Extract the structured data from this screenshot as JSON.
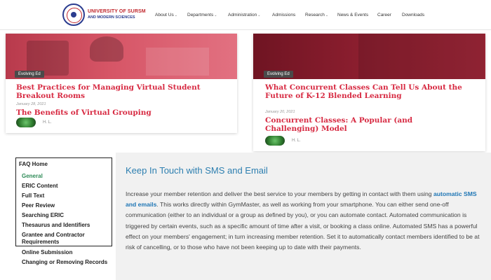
{
  "header": {
    "logo_line1": "UNIVERSITY OF SURSM",
    "logo_line2": "AND MODERN SCIENCES",
    "nav": [
      {
        "label": "About Us",
        "dropdown": true
      },
      {
        "label": "Departments",
        "dropdown": true
      },
      {
        "label": "Administration",
        "dropdown": true
      },
      {
        "label": "Admissions",
        "dropdown": false
      },
      {
        "label": "Research",
        "dropdown": true
      },
      {
        "label": "News & Events",
        "dropdown": false
      },
      {
        "label": "Career",
        "dropdown": false
      },
      {
        "label": "Downloads",
        "dropdown": false
      }
    ]
  },
  "cards": [
    {
      "tag": "Evolving Ed",
      "title": "Best Practices for Managing Virtual Student Breakout Rooms",
      "date": "January 28, 2021",
      "title2": "The Benefits of Virtual Grouping",
      "author": "H. L."
    },
    {
      "tag": "Evolving Ed",
      "title": "What Concurrent Classes Can Tell Us About the Future of K-12 Blended Learning",
      "date": "January 20, 2021",
      "title2": "Concurrent Classes: A Popular (and Challenging) Model",
      "author": "H. L."
    }
  ],
  "sidebar": {
    "items": [
      {
        "label": "FAQ Home"
      },
      {
        "label": "General"
      },
      {
        "label": "ERIC Content"
      },
      {
        "label": "Full Text"
      },
      {
        "label": "Peer Review"
      },
      {
        "label": "Searching ERIC"
      },
      {
        "label": "Thesaurus and Identifiers"
      },
      {
        "label": "Grantee and Contractor Requirements"
      },
      {
        "label": "Online Submission"
      },
      {
        "label": "Changing or Removing Records"
      }
    ]
  },
  "main": {
    "heading": "Keep In Touch with SMS and Email",
    "text_before_link": "Increase your member retention and deliver the best service to your members by getting in contact with them using ",
    "link_text": "automatic SMS and emails",
    "text_after_link": ". This works directly within GymMaster, as well as working from your smartphone. You can either send one-off communication (either to an individual or a group as defined by you), or you can automate contact. Automated communication is triggered by certain events, such as a specific amount of time after a visit, or booking a class online. Automated SMS has a powerful effect on your members' engagement; in turn increasing member retention. Set it to automatically contact members identified to be at risk of cancelling, or to those who have not been keeping up to date with their payments."
  },
  "colors": {
    "accent_red": "#d72a42",
    "link_blue": "#1f76b5",
    "heading_blue": "#2d7fb0",
    "active_green": "#2e8b57"
  }
}
